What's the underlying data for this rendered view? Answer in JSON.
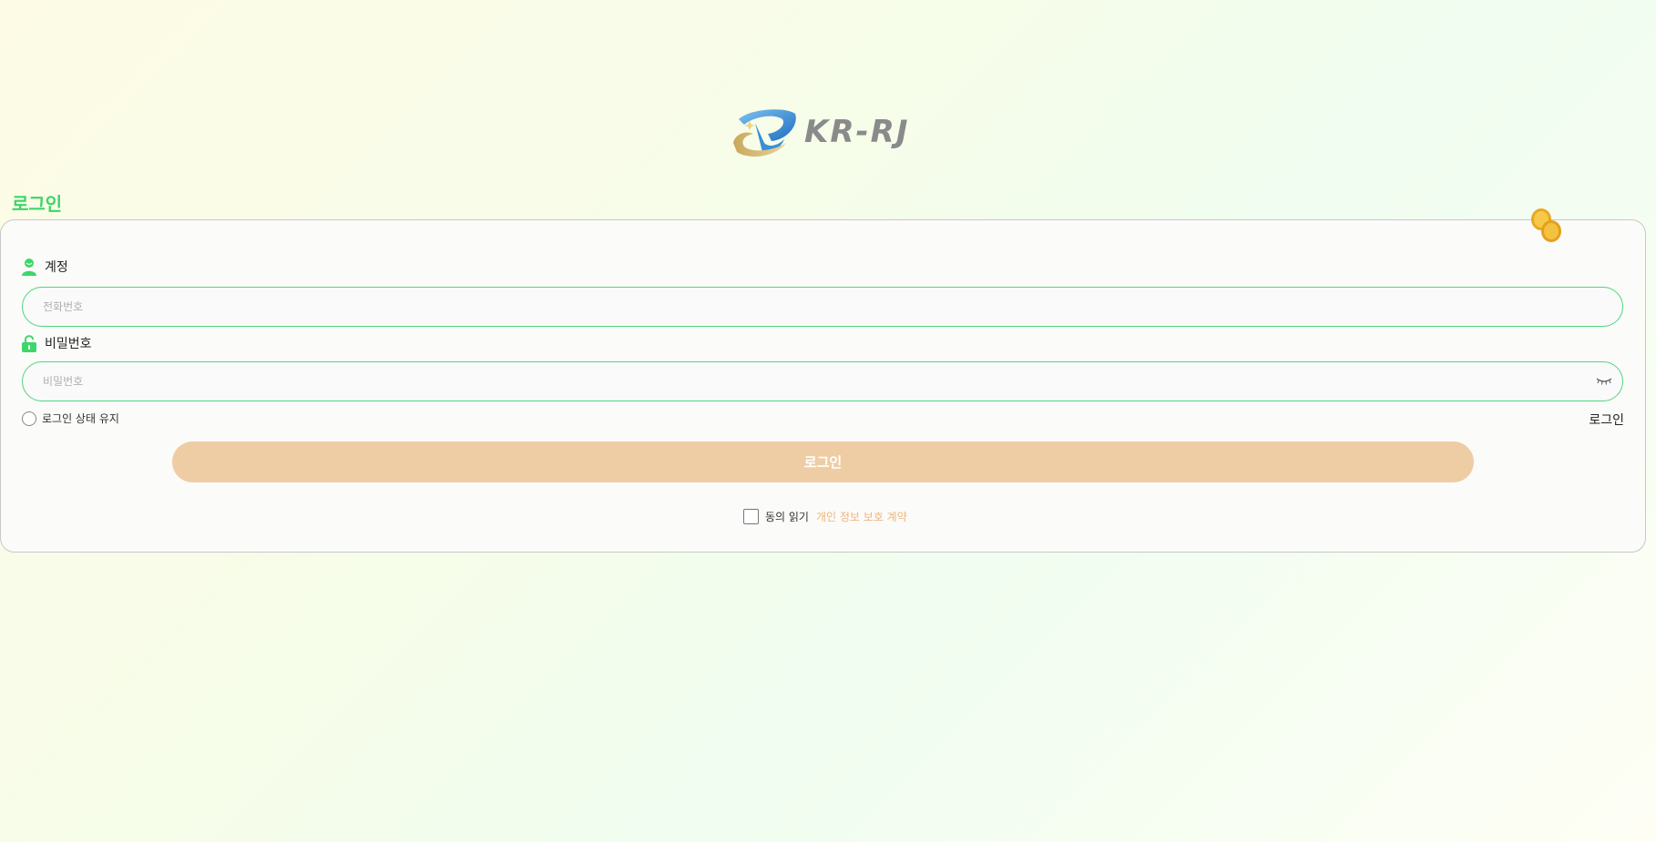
{
  "brand": {
    "logo_text": "KR-RJ"
  },
  "page": {
    "title": "로그인"
  },
  "form": {
    "account": {
      "label": "계정",
      "placeholder": "전화번호",
      "value": "",
      "icon": "user-icon"
    },
    "password": {
      "label": "비밀번호",
      "placeholder": "비밀번호",
      "value": "",
      "icon": "lock-icon",
      "toggle_icon": "eye-closed-icon"
    },
    "remember_label": "로그인 상태 유지",
    "login_link": "로그인",
    "submit_label": "로그인",
    "agree_label": "동의 읽기",
    "privacy_link": "개인 정보 보호 계약"
  },
  "colors": {
    "accent": "#3dd66a",
    "input_border": "#4fd67c",
    "button": "#efcda4",
    "privacy_link": "#f0b57a",
    "logo_text": "#8a8a8a"
  }
}
